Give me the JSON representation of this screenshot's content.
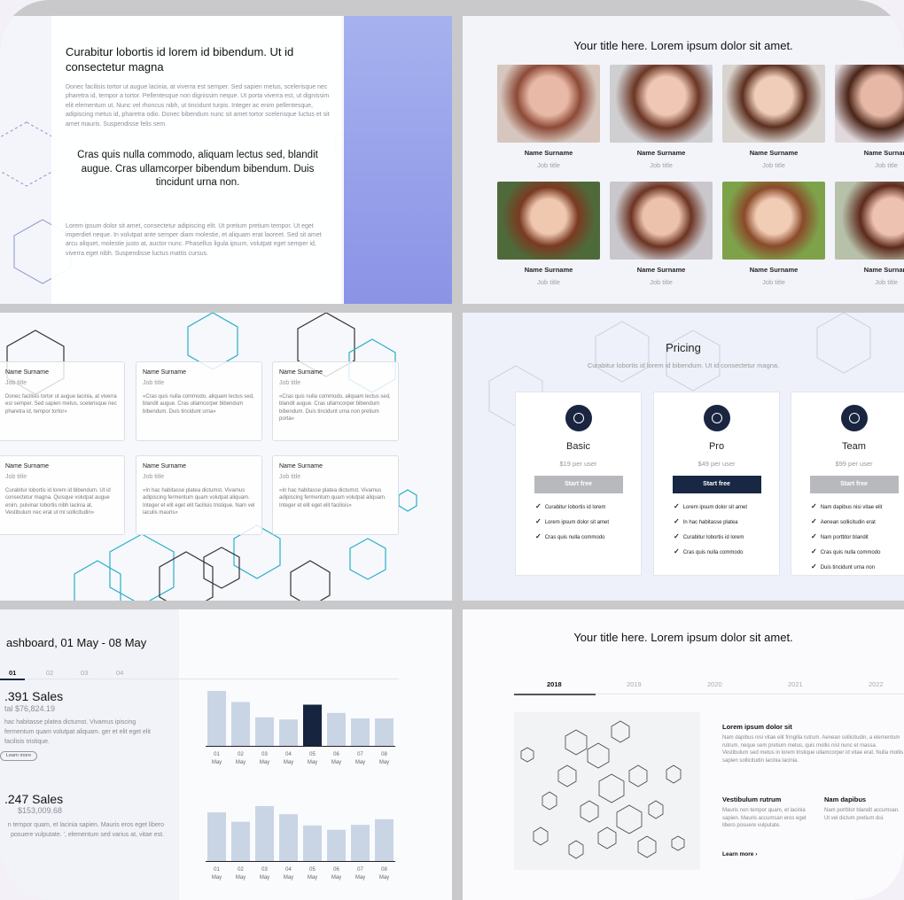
{
  "slide1": {
    "heading": "Curabitur lobortis id lorem id bibendum. Ut id consectetur magna",
    "para1": "Donec facilisis tortor ut augue lacinia, at viverra est semper. Sed sapien metus, scelerisque nec pharetra id, tempor a tortor. Pellentesque non dignissim neque. Ut porta viverra est, ut dignissim elit elementum ut. Nunc vel rhoncus nibh, ut tincidunt turpis. Integer ac enim pellentesque, adipiscing metus id, pharetra odio. Donec bibendum nunc sit amet tortor scelerisque luctus et sit amet mauris. Suspendisse felis sem.",
    "quote": "Cras quis nulla commodo, aliquam lectus sed, blandit augue. Cras ullamcorper bibendum bibendum. Duis tincidunt urna non.",
    "para2": "Lorem ipsum dolor sit amet, consectetur adipiscing elit. Ut pretium pretium tempor. Ut eget imperdiet neque. In volutpat ante semper diam molestie, et aliquam erat laoreet. Sed sit amet arcu aliquet, molestie justo at, auctor nunc. Phasellus ligula ipsum, volutpat eget semper id, viverra eget nibh. Suspendisse luctus mattis cursus."
  },
  "slide2": {
    "title": "Your title here. Lorem ipsum dolor sit amet.",
    "people": [
      {
        "name": "Name Surname",
        "job": "Job title"
      },
      {
        "name": "Name Surname",
        "job": "Job title"
      },
      {
        "name": "Name Surname",
        "job": "Job title"
      },
      {
        "name": "Name Surnam",
        "job": "Job title"
      },
      {
        "name": "Name Surname",
        "job": "Job title"
      },
      {
        "name": "Name Surname",
        "job": "Job title"
      },
      {
        "name": "Name Surname",
        "job": "Job title"
      },
      {
        "name": "Name Surnam",
        "job": "Job title"
      }
    ]
  },
  "slide3": {
    "cards": [
      {
        "name": "Name Surname",
        "job": "Job title",
        "text": "Donec facilisis tortor ut augue lacinia, at viverra est semper. Sed sapien metus, scelerisque nec pharetra id, tempor tortor»"
      },
      {
        "name": "Name Surname",
        "job": "Job title",
        "text": "«Cras quis nulla commodo, aliquam lectus sed, blandit augue. Cras ullamcorper bibendum bibendum. Duis tincidunt urna»"
      },
      {
        "name": "Name Surname",
        "job": "Job title",
        "text": "«Cras quis nulla commodo, aliquam lectus sed, blandit augue. Cras ullamcorper bibendum bibendum. Duis tincidunt urna non pretium porta»"
      },
      {
        "name": "Name Surname",
        "job": "Job title",
        "text": "Curabitur lobortis id lorem id bibendum. Ut id consectetur magna. Quisque volutpat augue enim, pulvinar lobortis nibh lacinia at. Vestibulum nec erat ut mi sollicitudin»"
      },
      {
        "name": "Name Surname",
        "job": "Job title",
        "text": "«In hac habitasse platea dictumst. Vivamus adipiscing fermentum quam volutpat aliquam. Integer et elit eget elit facilisis tristique. Nam vel iaculis mauris»"
      },
      {
        "name": "Name Surname",
        "job": "Job title",
        "text": "«In hac habitasse platea dictumst. Vivamus adipiscing fermentum quam volutpat aliquam. Integer et elit eget elit facilisis»"
      }
    ]
  },
  "slide4": {
    "title": "Pricing",
    "subtitle": "Curabitur lobortis id lorem id bibendum. Ut id consectetur magna.",
    "plans": [
      {
        "name": "Basic",
        "price": "$19 per user",
        "button": "Start free",
        "features": [
          "Curabitur lobortis id lorem",
          "Lorem ipsum dolor sit amet",
          "Cras quis nulla commodo"
        ]
      },
      {
        "name": "Pro",
        "price": "$49 per user",
        "button": "Start free",
        "features": [
          "Lorem ipsum dolor sit amet",
          "In hac habitasse platea",
          "Curabitur lobortis id lorem",
          "Cras quis nulla commodo"
        ]
      },
      {
        "name": "Team",
        "price": "$99 per user",
        "button": "Start free",
        "features": [
          "Nam dapibus nisi vitae elit",
          "Aenean sollicitudin erat",
          "Nam porttitor blandit",
          "Cras quis nulla commodo",
          "Duis tincidunt urna non"
        ]
      }
    ]
  },
  "slide5": {
    "title": "ashboard, 01 May - 08 May",
    "tabs": [
      "01",
      "02",
      "03",
      "04"
    ],
    "block1": {
      "sales": ".391 Sales",
      "total": "tal $76,824.19",
      "desc": "hac habitasse platea dictumst. Vivamus ipiscing fermentum quam volutpat aliquam. ger et elit eget elit facilisis tristique.",
      "button": "Learn more"
    },
    "block2": {
      "sales": ".247 Sales",
      "total": "$153,009.68",
      "desc": "n tempor quam, et lacinia sapien. Mauris eros eget libero posuere vulputate. ', elementum sed varius at, vitae est."
    },
    "chart_data": [
      {
        "type": "bar",
        "categories": [
          "01",
          "02",
          "03",
          "04",
          "05",
          "06",
          "07",
          "08"
        ],
        "sublabels": [
          "May",
          "May",
          "May",
          "May",
          "May",
          "May",
          "May",
          "May"
        ],
        "values": [
          100,
          80,
          52,
          48,
          75,
          60,
          50,
          50
        ],
        "highlight_index": 4,
        "colors": {
          "bar": "#c9d5e5",
          "highlight": "#17243f"
        }
      },
      {
        "type": "bar",
        "categories": [
          "01",
          "02",
          "03",
          "04",
          "05",
          "06",
          "07",
          "08"
        ],
        "sublabels": [
          "May",
          "May",
          "May",
          "May",
          "May",
          "May",
          "May",
          "May"
        ],
        "values": [
          78,
          63,
          88,
          75,
          57,
          50,
          58,
          67
        ],
        "colors": {
          "bar": "#c9d5e5"
        }
      }
    ]
  },
  "slide6": {
    "title": "Your title here. Lorem ipsum dolor sit amet.",
    "years": [
      "2018",
      "2019",
      "2020",
      "2021",
      "2022"
    ],
    "h1": "Lorem ipsum dolor sit",
    "t1": "Nam dapibus nisi vitae elit fringilla rutrum. Aenean sollicitudin, a elementum rutrum, neque sem pretium metus, quis mollis nisl nunc et massa. Vestibulum sed metus in lorem tristique ullamcorper id vitae erat. Nulla mollis sapien sollicitudin lacinia lacinia.",
    "h2": "Vestibulum rutrum",
    "t2": "Mauris non tempor quam, et lacinia sapien. Mauris accumsan eros eget libero posuere vulputate.",
    "h3": "Nam dapibus",
    "t3": "Nam porttitor blandit accumsan. Ut vel dictum pretium dui.",
    "more": "Learn more"
  }
}
